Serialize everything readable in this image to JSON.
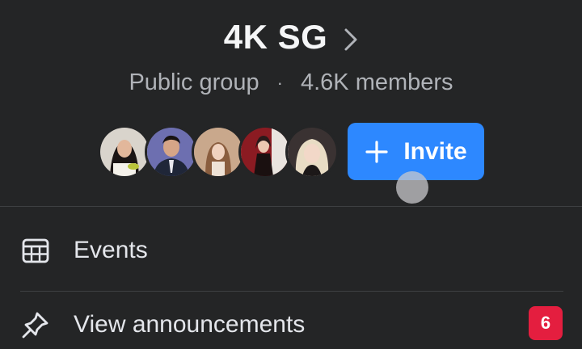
{
  "group": {
    "name": "4K SG",
    "privacy": "Public group",
    "separator": "·",
    "members": "4.6K members"
  },
  "members_preview": {
    "avatars": [
      "member-avatar-1",
      "member-avatar-2",
      "member-avatar-3",
      "member-avatar-4",
      "member-avatar-5"
    ]
  },
  "invite_button": {
    "label": "Invite",
    "icon": "plus-icon",
    "color": "#2d88ff"
  },
  "menu": {
    "events": {
      "label": "Events",
      "icon": "calendar-icon"
    },
    "announcements": {
      "label": "View announcements",
      "icon": "pin-icon",
      "badge": "6",
      "badge_color": "#e41e3f"
    }
  },
  "colors": {
    "background": "#242526",
    "divider": "#3e4042",
    "secondary_text": "#b0b3b8"
  }
}
